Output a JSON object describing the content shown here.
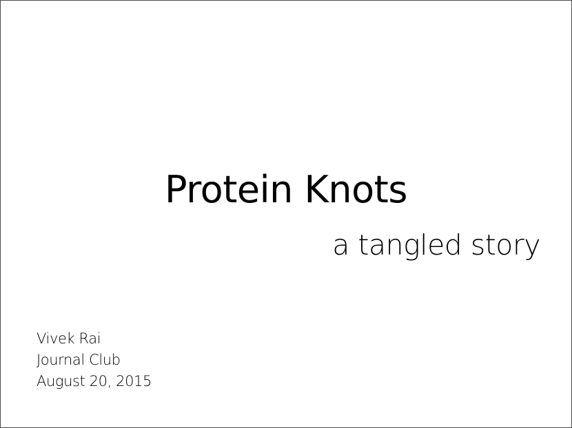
{
  "slide": {
    "title": "Protein Knots",
    "subtitle": "a tangled story",
    "author": "Vivek Rai",
    "event": "Journal Club",
    "date": "August 20, 2015"
  }
}
